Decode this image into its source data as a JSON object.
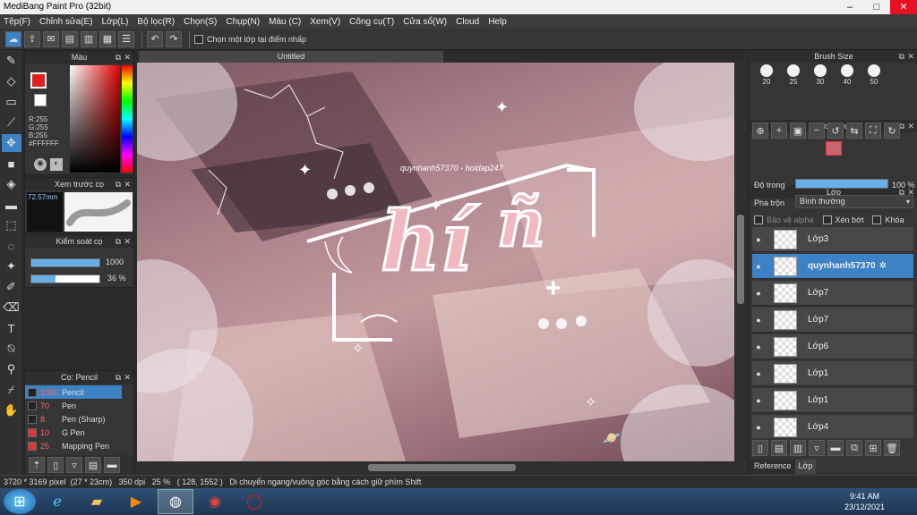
{
  "window": {
    "title": "MediBang Paint Pro (32bit)",
    "minimize": "–",
    "maximize": "□",
    "close": "✕"
  },
  "menu": [
    "Tệp(F)",
    "Chỉnh sửa(E)",
    "Lớp(L)",
    "Bộ lọc(R)",
    "Chọn(S)",
    "Chụp(N)",
    "Màu (C)",
    "Xem(V)",
    "Công cụ(T)",
    "Cửa sổ(W)",
    "Cloud",
    "Help"
  ],
  "toolbar": {
    "select_layer_label": "Chọn một lớp tại điểm nhấp"
  },
  "color_panel": {
    "title": "Màu",
    "r": "R:255",
    "g": "G:255",
    "b": "B:255",
    "hex": "#FFFFFF"
  },
  "brush_preview": {
    "title": "Xem trước cọ",
    "size": "72.57mm"
  },
  "brush_control": {
    "title": "Kiểm soát cọ",
    "size_value": "1000",
    "opacity_value": "36 %",
    "size_fraction": 1.0,
    "opacity_fraction": 0.36
  },
  "brush_list": {
    "title": "Cọ: Pencil",
    "items": [
      {
        "size": "1000",
        "name": "Pencil",
        "color": "#222222",
        "selected": true
      },
      {
        "size": "70",
        "name": "Pen",
        "color": "#222222",
        "selected": false
      },
      {
        "size": "8",
        "name": "Pen (Sharp)",
        "color": "#222222",
        "selected": false
      },
      {
        "size": "10",
        "name": "G Pen",
        "color": "#e23636",
        "selected": false
      },
      {
        "size": "25",
        "name": "Mapping Pen",
        "color": "#e23636",
        "selected": false
      }
    ]
  },
  "document": {
    "tab": "Untitled"
  },
  "artwork": {
    "watermark": "quynhanh57370 - hoidap247",
    "main_text": "hí",
    "second_text": "ñ"
  },
  "brush_size_panel": {
    "title": "Brush Size",
    "sizes": [
      "20",
      "25",
      "30",
      "40",
      "50"
    ]
  },
  "navigator": {
    "title": "Hoa tiêu"
  },
  "layers_panel": {
    "title": "Lớp",
    "opacity_label": "Độ trong",
    "opacity_value": "100 %",
    "opacity_fraction": 1.0,
    "blend_label": "Pha trộn",
    "blend_value": "Bình thường",
    "protect_alpha": "Bảo vệ alpha",
    "clipping": "Xén bớt",
    "lock": "Khóa",
    "layers": [
      {
        "name": "Lớp3",
        "selected": false
      },
      {
        "name": "quynhanh57370",
        "selected": true
      },
      {
        "name": "Lớp7",
        "selected": false
      },
      {
        "name": "Lớp7",
        "selected": false
      },
      {
        "name": "Lớp6",
        "selected": false
      },
      {
        "name": "Lớp1",
        "selected": false
      },
      {
        "name": "Lớp1",
        "selected": false
      },
      {
        "name": "Lớp4",
        "selected": false
      }
    ],
    "tabs": [
      "Reference",
      "Lớp"
    ]
  },
  "status": {
    "dimensions": "3720 * 3169 pixel",
    "size_cm": "(27 * 23cm)",
    "dpi": "350 dpi",
    "zoom": "25 %",
    "coords": "( 128, 1552 )",
    "hint": "Di chuyển ngang/vuông góc bằng cách giữ phím Shift"
  },
  "taskbar": {
    "time": "9:41 AM",
    "date": "23/12/2021"
  }
}
